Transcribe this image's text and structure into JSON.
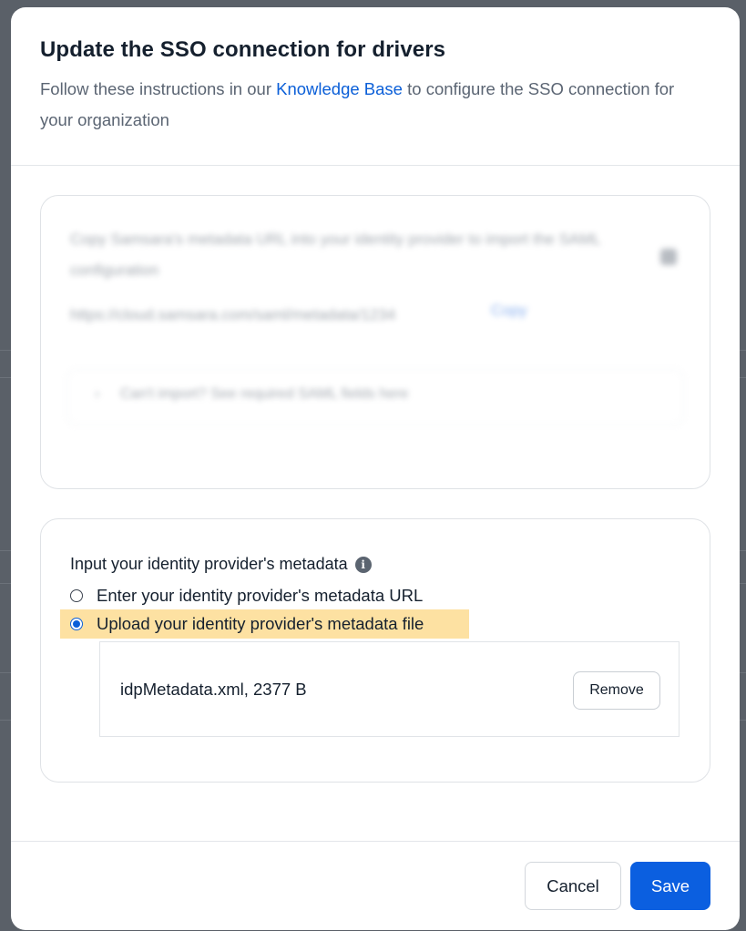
{
  "modal": {
    "title": "Update the SSO connection for drivers",
    "subtitle_before": "Follow these instructions in our ",
    "subtitle_link": "Knowledge Base",
    "subtitle_after": " to configure the SSO connection for your organization"
  },
  "import_section": {
    "instruction": "Copy Samsara's metadata URL into your identity provider to import the SAML configuration",
    "metadata_url": "https://cloud.samsara.com/saml/metadata/1234",
    "copy_label": "Copy",
    "fallback_label": "Can't import? See required SAML fields here"
  },
  "metadata_section": {
    "label": "Input your identity provider's metadata",
    "options": [
      {
        "label": "Enter your identity provider's metadata URL",
        "selected": false
      },
      {
        "label": "Upload your identity provider's metadata file",
        "selected": true
      }
    ],
    "uploaded_file": "idpMetadata.xml, 2377 B",
    "remove_label": "Remove"
  },
  "footer": {
    "cancel_label": "Cancel",
    "save_label": "Save"
  },
  "colors": {
    "accent": "#0b5fe0",
    "highlight": "#fde1a2",
    "overlay": "#5a6068"
  },
  "icons": {
    "info": "info-icon",
    "copy": "copy-icon",
    "chevron": "chevron-right-icon"
  }
}
